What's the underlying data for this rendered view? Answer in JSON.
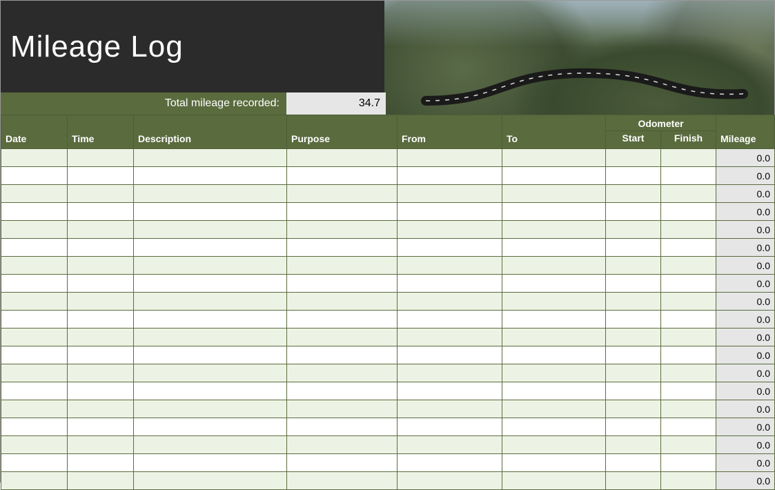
{
  "title": "Mileage Log",
  "total": {
    "label": "Total mileage recorded:",
    "value": "34.7"
  },
  "columns": {
    "date": "Date",
    "time": "Time",
    "description": "Description",
    "purpose": "Purpose",
    "from": "From",
    "to": "To",
    "odometer_group": "Odometer",
    "start": "Start",
    "finish": "Finish",
    "mileage": "Mileage"
  },
  "rows": [
    {
      "date": "",
      "time": "",
      "description": "",
      "purpose": "",
      "from": "",
      "to": "",
      "start": "",
      "finish": "",
      "mileage": "0.0"
    },
    {
      "date": "",
      "time": "",
      "description": "",
      "purpose": "",
      "from": "",
      "to": "",
      "start": "",
      "finish": "",
      "mileage": "0.0"
    },
    {
      "date": "",
      "time": "",
      "description": "",
      "purpose": "",
      "from": "",
      "to": "",
      "start": "",
      "finish": "",
      "mileage": "0.0"
    },
    {
      "date": "",
      "time": "",
      "description": "",
      "purpose": "",
      "from": "",
      "to": "",
      "start": "",
      "finish": "",
      "mileage": "0.0"
    },
    {
      "date": "",
      "time": "",
      "description": "",
      "purpose": "",
      "from": "",
      "to": "",
      "start": "",
      "finish": "",
      "mileage": "0.0"
    },
    {
      "date": "",
      "time": "",
      "description": "",
      "purpose": "",
      "from": "",
      "to": "",
      "start": "",
      "finish": "",
      "mileage": "0.0"
    },
    {
      "date": "",
      "time": "",
      "description": "",
      "purpose": "",
      "from": "",
      "to": "",
      "start": "",
      "finish": "",
      "mileage": "0.0"
    },
    {
      "date": "",
      "time": "",
      "description": "",
      "purpose": "",
      "from": "",
      "to": "",
      "start": "",
      "finish": "",
      "mileage": "0.0"
    },
    {
      "date": "",
      "time": "",
      "description": "",
      "purpose": "",
      "from": "",
      "to": "",
      "start": "",
      "finish": "",
      "mileage": "0.0"
    },
    {
      "date": "",
      "time": "",
      "description": "",
      "purpose": "",
      "from": "",
      "to": "",
      "start": "",
      "finish": "",
      "mileage": "0.0"
    },
    {
      "date": "",
      "time": "",
      "description": "",
      "purpose": "",
      "from": "",
      "to": "",
      "start": "",
      "finish": "",
      "mileage": "0.0"
    },
    {
      "date": "",
      "time": "",
      "description": "",
      "purpose": "",
      "from": "",
      "to": "",
      "start": "",
      "finish": "",
      "mileage": "0.0"
    },
    {
      "date": "",
      "time": "",
      "description": "",
      "purpose": "",
      "from": "",
      "to": "",
      "start": "",
      "finish": "",
      "mileage": "0.0"
    },
    {
      "date": "",
      "time": "",
      "description": "",
      "purpose": "",
      "from": "",
      "to": "",
      "start": "",
      "finish": "",
      "mileage": "0.0"
    },
    {
      "date": "",
      "time": "",
      "description": "",
      "purpose": "",
      "from": "",
      "to": "",
      "start": "",
      "finish": "",
      "mileage": "0.0"
    },
    {
      "date": "",
      "time": "",
      "description": "",
      "purpose": "",
      "from": "",
      "to": "",
      "start": "",
      "finish": "",
      "mileage": "0.0"
    },
    {
      "date": "",
      "time": "",
      "description": "",
      "purpose": "",
      "from": "",
      "to": "",
      "start": "",
      "finish": "",
      "mileage": "0.0"
    },
    {
      "date": "",
      "time": "",
      "description": "",
      "purpose": "",
      "from": "",
      "to": "",
      "start": "",
      "finish": "",
      "mileage": "0.0"
    },
    {
      "date": "",
      "time": "",
      "description": "",
      "purpose": "",
      "from": "",
      "to": "",
      "start": "",
      "finish": "",
      "mileage": "0.0"
    }
  ]
}
